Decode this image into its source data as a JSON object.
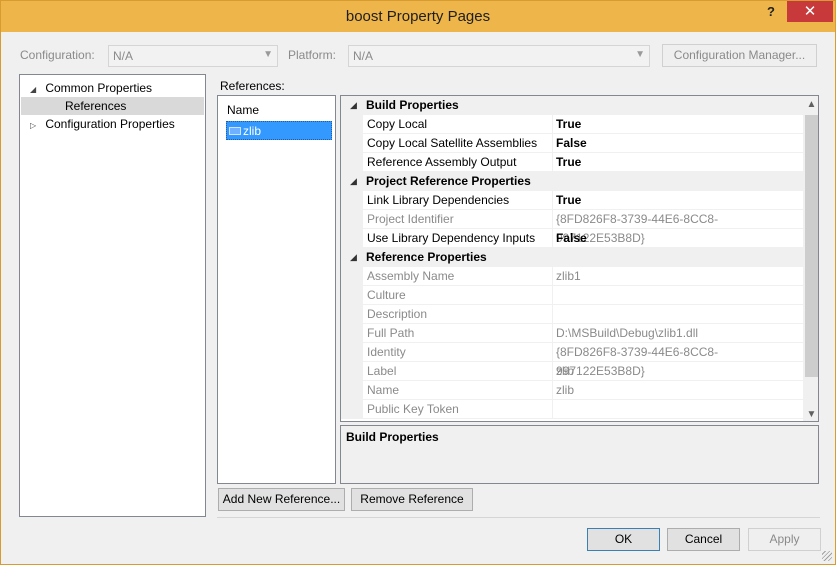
{
  "window": {
    "title": "boost Property Pages",
    "help": "?",
    "close": "✕"
  },
  "config": {
    "configuration_label": "Configuration:",
    "configuration_value": "N/A",
    "platform_label": "Platform:",
    "platform_value": "N/A",
    "manager_button": "Configuration Manager..."
  },
  "tree": {
    "items": [
      {
        "label": "Common Properties",
        "twisty": "◢"
      },
      {
        "label": "References"
      },
      {
        "label": "Configuration Properties",
        "twisty": "▷"
      }
    ]
  },
  "references": {
    "label": "References:",
    "column_header": "Name",
    "items": [
      {
        "label": "zlib"
      }
    ],
    "add_button": "Add New Reference...",
    "remove_button": "Remove Reference"
  },
  "grid": {
    "categories": [
      {
        "name": "Build Properties",
        "rows": [
          {
            "name": "Copy Local",
            "value": "True"
          },
          {
            "name": "Copy Local Satellite Assemblies",
            "value": "False"
          },
          {
            "name": "Reference Assembly Output",
            "value": "True"
          }
        ]
      },
      {
        "name": "Project Reference Properties",
        "rows": [
          {
            "name": "Link Library Dependencies",
            "value": "True"
          },
          {
            "name": "Project Identifier",
            "value": "{8FD826F8-3739-44E6-8CC8-997122E53B8D}"
          },
          {
            "name": "Use Library Dependency Inputs",
            "value": "False"
          }
        ]
      },
      {
        "name": "Reference Properties",
        "rows": [
          {
            "name": "Assembly Name",
            "value": "zlib1"
          },
          {
            "name": "Culture",
            "value": ""
          },
          {
            "name": "Description",
            "value": ""
          },
          {
            "name": "Full Path",
            "value": "D:\\MSBuild\\Debug\\zlib1.dll"
          },
          {
            "name": "Identity",
            "value": "{8FD826F8-3739-44E6-8CC8-997122E53B8D}"
          },
          {
            "name": "Label",
            "value": "zlib"
          },
          {
            "name": "Name",
            "value": "zlib"
          },
          {
            "name": "Public Key Token",
            "value": ""
          }
        ]
      }
    ]
  },
  "description": {
    "title": "Build Properties"
  },
  "buttons": {
    "ok": "OK",
    "cancel": "Cancel",
    "apply": "Apply"
  },
  "colors": {
    "titlebar": "#eeb54a",
    "close": "#c7393b",
    "selection": "#3399ff"
  }
}
